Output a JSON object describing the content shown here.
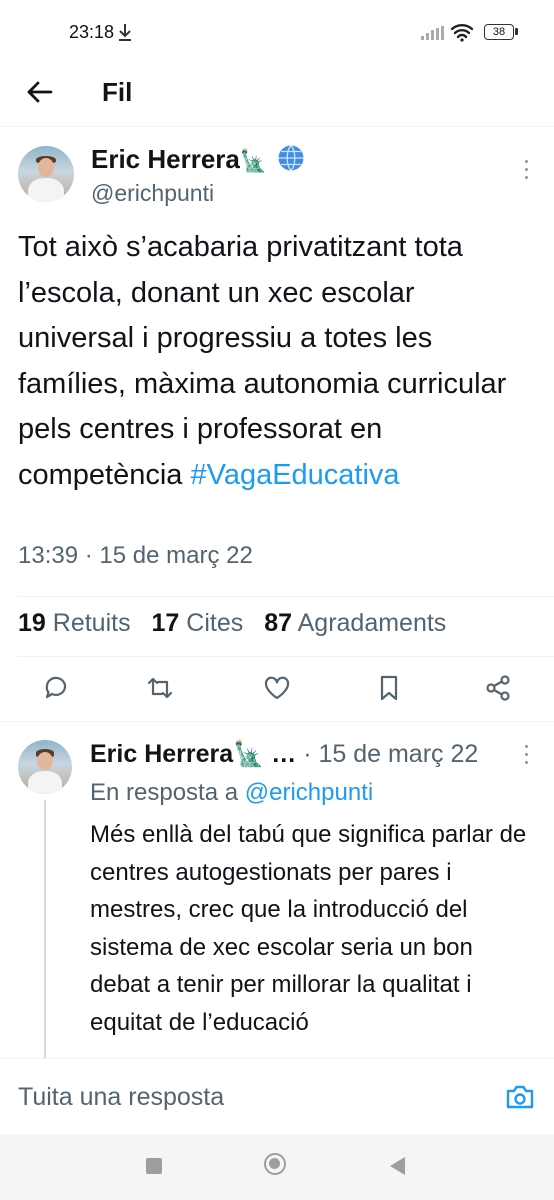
{
  "status_bar": {
    "time": "23:18",
    "battery": "38"
  },
  "header": {
    "title": "Fil"
  },
  "tweet": {
    "author_name": "Eric Herrera",
    "author_emoji": "🗽",
    "handle": "@erichpunti",
    "text": "Tot això s’acabaria privatitzant tota l’escola, donant un xec escolar universal i progressiu a totes les famílies, màxima autonomia curricular pels centres i professorat en competència ",
    "hashtag": "#VagaEducativa",
    "timestamp": "13:39 · 15 de març 22",
    "stats": {
      "retweets_count": "19",
      "retweets_label": "Retuits",
      "quotes_count": "17",
      "quotes_label": "Cites",
      "likes_count": "87",
      "likes_label": "Agradaments"
    }
  },
  "reply": {
    "author_name": "Eric Herrera🗽 …",
    "separator": "·",
    "date": "15 de març 22",
    "in_reply_prefix": "En resposta a ",
    "in_reply_handle": "@erichpunti",
    "text": "Més enllà del tabú que significa parlar de centres autogestionats per pares i mestres, crec que la introducció del sistema de xec escolar seria un bon debat a tenir per millorar la qualitat i equitat de l’educació"
  },
  "compose": {
    "placeholder": "Tuita una resposta"
  },
  "colors": {
    "accent": "#1d9bf0",
    "text": "#0f1419",
    "secondary": "#536471",
    "divider": "#eff3f4"
  },
  "icons": [
    "download-icon",
    "signal-icon",
    "wifi-icon",
    "back-arrow-icon",
    "globe-icon",
    "more-icon",
    "reply-icon",
    "retweet-icon",
    "like-icon",
    "bookmark-icon",
    "share-icon",
    "camera-icon"
  ]
}
